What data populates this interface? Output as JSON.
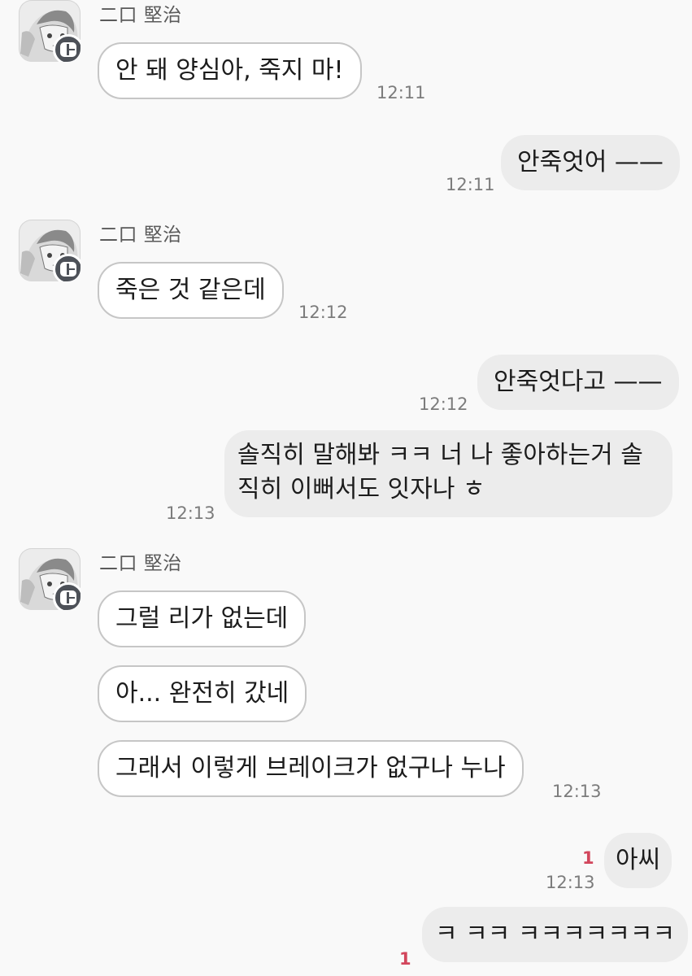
{
  "contact": {
    "name": "二口 堅治",
    "avatar_icon": "anime-avatar-icon",
    "badge_icon": "talk-badge-icon"
  },
  "messages": [
    {
      "dir": "in",
      "text": "안 돼 양심아, 죽지 마!",
      "time": "12:11"
    },
    {
      "dir": "out",
      "text": "안죽엇어 ——",
      "time": "12:11"
    },
    {
      "dir": "in",
      "text": "죽은 것 같은데",
      "time": "12:12"
    },
    {
      "dir": "out",
      "text": "안죽엇다고 ——",
      "time": "12:12"
    },
    {
      "dir": "out",
      "text": "솔직히 말해봐 ㅋㅋ 너 나 좋아하는거 솔직히 이뻐서도 잇자나 ㅎ",
      "time": "12:13"
    },
    {
      "dir": "in",
      "text": "그럴 리가 없는데",
      "time": ""
    },
    {
      "dir": "in",
      "text": "아... 완전히 갔네",
      "time": ""
    },
    {
      "dir": "in",
      "text": "그래서 이렇게 브레이크가 없구나 누나",
      "time": "12:13"
    },
    {
      "dir": "out",
      "text": "아씨",
      "time": "12:13",
      "unread": "1"
    },
    {
      "dir": "out",
      "text": "ㅋ ㅋㅋ ㅋㅋㅋㅋㅋㅋㅋ",
      "time": "",
      "unread": "1"
    }
  ],
  "colors": {
    "background": "#f9f9f9",
    "incoming_bubble": "#ffffff",
    "outgoing_bubble": "#ececec",
    "unread_count": "#d2465c"
  }
}
